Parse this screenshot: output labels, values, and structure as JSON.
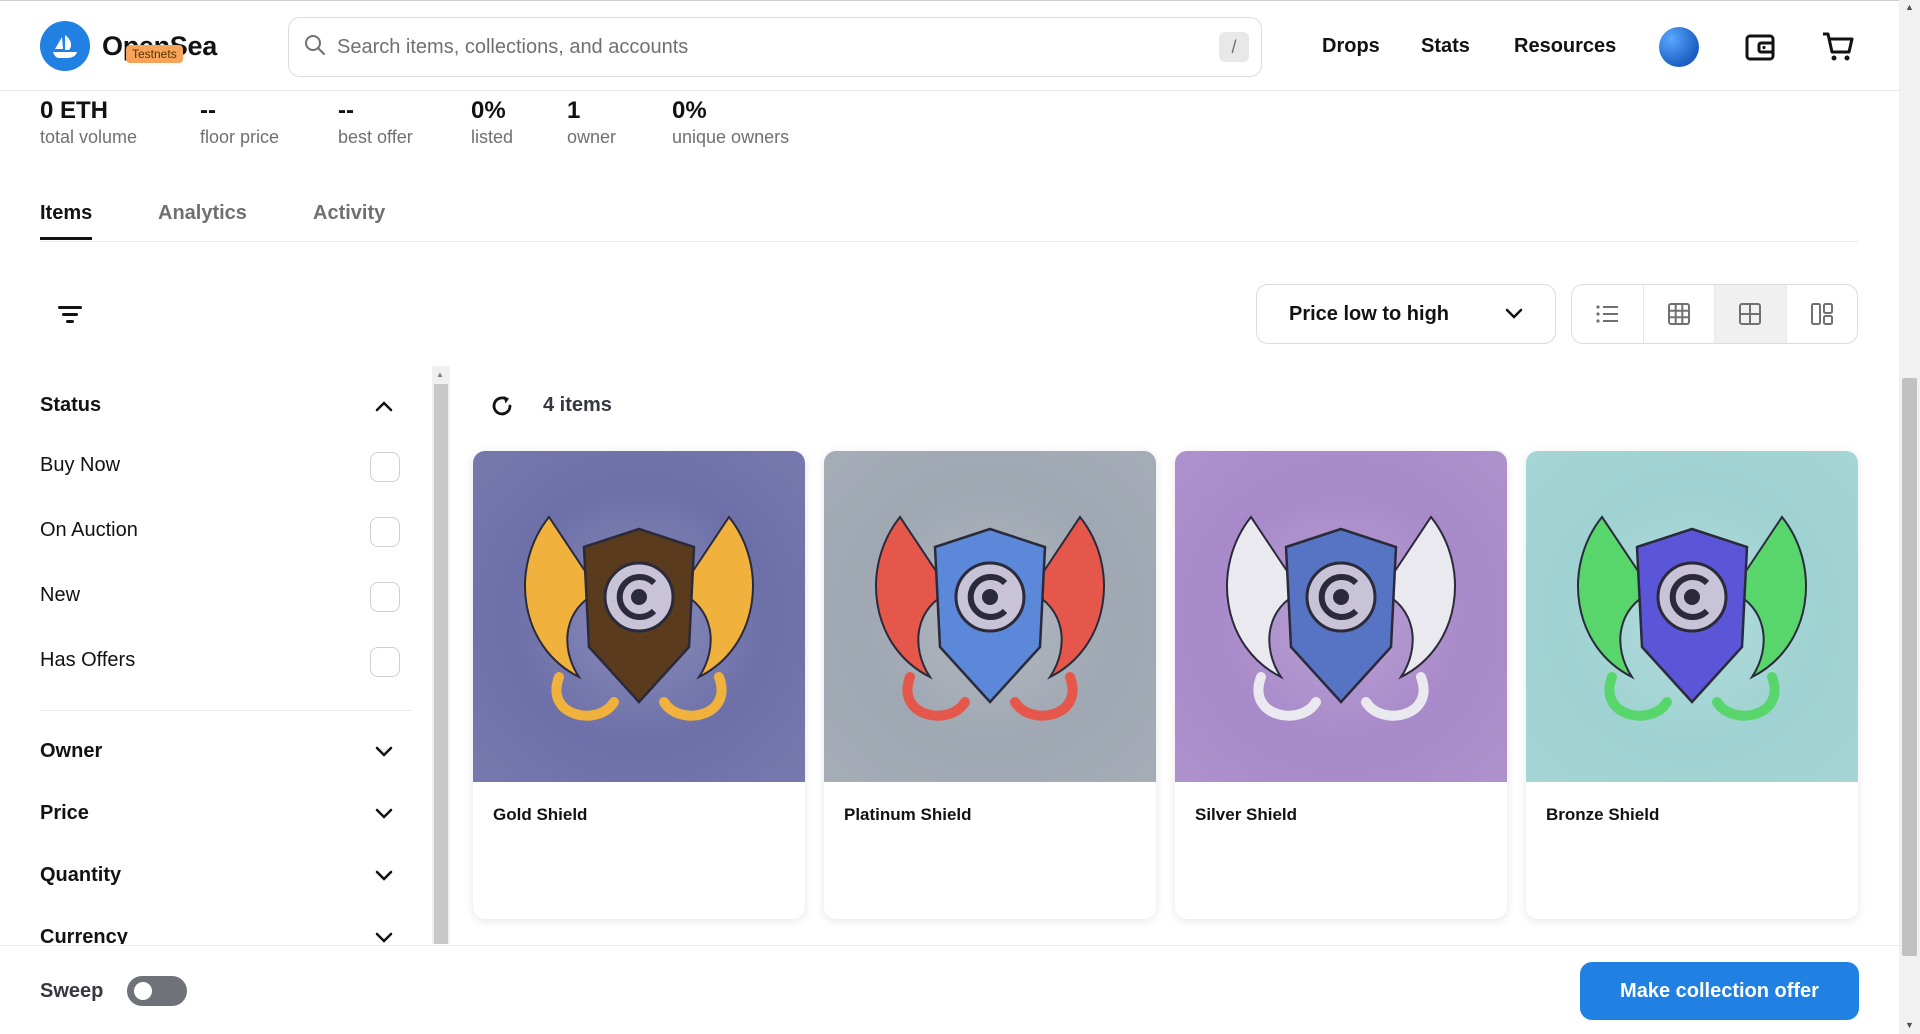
{
  "header": {
    "logo_text": "OpenSea",
    "testnets_badge": "Testnets",
    "search_placeholder": "Search items, collections, and accounts",
    "search_shortcut": "/",
    "nav": [
      "Drops",
      "Stats",
      "Resources"
    ]
  },
  "stats": [
    {
      "value": "0 ETH",
      "label": "total volume"
    },
    {
      "value": "--",
      "label": "floor price"
    },
    {
      "value": "--",
      "label": "best offer"
    },
    {
      "value": "0%",
      "label": "listed"
    },
    {
      "value": "1",
      "label": "owner"
    },
    {
      "value": "0%",
      "label": "unique owners"
    }
  ],
  "tabs": [
    "Items",
    "Analytics",
    "Activity"
  ],
  "toolbar": {
    "sort_value": "Price low to high"
  },
  "sidebar": {
    "status_title": "Status",
    "status_options": [
      "Buy Now",
      "On Auction",
      "New",
      "Has Offers"
    ],
    "sections": [
      "Owner",
      "Price",
      "Quantity",
      "Currency"
    ]
  },
  "items": {
    "count_label": "4 items",
    "cards": [
      {
        "name": "Gold Shield",
        "bg": "#6d70a8",
        "wing": "#f0b23c",
        "core": "#5a3b1e"
      },
      {
        "name": "Platinum Shield",
        "bg": "#9fa7b2",
        "wing": "#e4574a",
        "core": "#5b88d8"
      },
      {
        "name": "Silver Shield",
        "bg": "#a889c9",
        "wing": "#e9e9ef",
        "core": "#5673c4"
      },
      {
        "name": "Bronze Shield",
        "bg": "#9fd2d2",
        "wing": "#59d66b",
        "core": "#5b55d8"
      }
    ]
  },
  "footer": {
    "sweep_label": "Sweep",
    "offer_button": "Make collection offer"
  },
  "colors": {
    "accent": "#2081e2",
    "badge": "#f7a35a"
  }
}
